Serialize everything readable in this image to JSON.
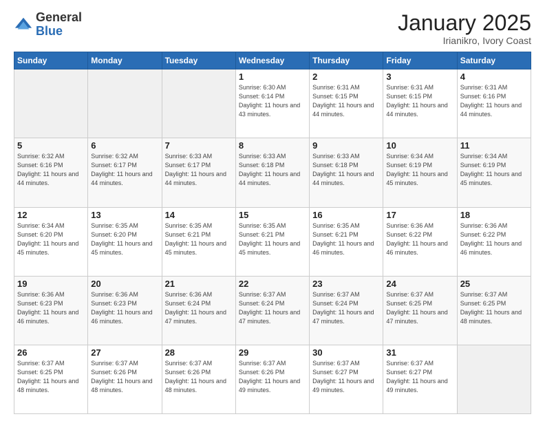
{
  "logo": {
    "general": "General",
    "blue": "Blue"
  },
  "title": "January 2025",
  "location": "Irianikro, Ivory Coast",
  "days_of_week": [
    "Sunday",
    "Monday",
    "Tuesday",
    "Wednesday",
    "Thursday",
    "Friday",
    "Saturday"
  ],
  "weeks": [
    [
      {
        "day": "",
        "info": "",
        "empty": true
      },
      {
        "day": "",
        "info": "",
        "empty": true
      },
      {
        "day": "",
        "info": "",
        "empty": true
      },
      {
        "day": "1",
        "info": "Sunrise: 6:30 AM\nSunset: 6:14 PM\nDaylight: 11 hours\nand 43 minutes."
      },
      {
        "day": "2",
        "info": "Sunrise: 6:31 AM\nSunset: 6:15 PM\nDaylight: 11 hours\nand 44 minutes."
      },
      {
        "day": "3",
        "info": "Sunrise: 6:31 AM\nSunset: 6:15 PM\nDaylight: 11 hours\nand 44 minutes."
      },
      {
        "day": "4",
        "info": "Sunrise: 6:31 AM\nSunset: 6:16 PM\nDaylight: 11 hours\nand 44 minutes."
      }
    ],
    [
      {
        "day": "5",
        "info": "Sunrise: 6:32 AM\nSunset: 6:16 PM\nDaylight: 11 hours\nand 44 minutes."
      },
      {
        "day": "6",
        "info": "Sunrise: 6:32 AM\nSunset: 6:17 PM\nDaylight: 11 hours\nand 44 minutes."
      },
      {
        "day": "7",
        "info": "Sunrise: 6:33 AM\nSunset: 6:17 PM\nDaylight: 11 hours\nand 44 minutes."
      },
      {
        "day": "8",
        "info": "Sunrise: 6:33 AM\nSunset: 6:18 PM\nDaylight: 11 hours\nand 44 minutes."
      },
      {
        "day": "9",
        "info": "Sunrise: 6:33 AM\nSunset: 6:18 PM\nDaylight: 11 hours\nand 44 minutes."
      },
      {
        "day": "10",
        "info": "Sunrise: 6:34 AM\nSunset: 6:19 PM\nDaylight: 11 hours\nand 45 minutes."
      },
      {
        "day": "11",
        "info": "Sunrise: 6:34 AM\nSunset: 6:19 PM\nDaylight: 11 hours\nand 45 minutes."
      }
    ],
    [
      {
        "day": "12",
        "info": "Sunrise: 6:34 AM\nSunset: 6:20 PM\nDaylight: 11 hours\nand 45 minutes."
      },
      {
        "day": "13",
        "info": "Sunrise: 6:35 AM\nSunset: 6:20 PM\nDaylight: 11 hours\nand 45 minutes."
      },
      {
        "day": "14",
        "info": "Sunrise: 6:35 AM\nSunset: 6:21 PM\nDaylight: 11 hours\nand 45 minutes."
      },
      {
        "day": "15",
        "info": "Sunrise: 6:35 AM\nSunset: 6:21 PM\nDaylight: 11 hours\nand 45 minutes."
      },
      {
        "day": "16",
        "info": "Sunrise: 6:35 AM\nSunset: 6:21 PM\nDaylight: 11 hours\nand 46 minutes."
      },
      {
        "day": "17",
        "info": "Sunrise: 6:36 AM\nSunset: 6:22 PM\nDaylight: 11 hours\nand 46 minutes."
      },
      {
        "day": "18",
        "info": "Sunrise: 6:36 AM\nSunset: 6:22 PM\nDaylight: 11 hours\nand 46 minutes."
      }
    ],
    [
      {
        "day": "19",
        "info": "Sunrise: 6:36 AM\nSunset: 6:23 PM\nDaylight: 11 hours\nand 46 minutes."
      },
      {
        "day": "20",
        "info": "Sunrise: 6:36 AM\nSunset: 6:23 PM\nDaylight: 11 hours\nand 46 minutes."
      },
      {
        "day": "21",
        "info": "Sunrise: 6:36 AM\nSunset: 6:24 PM\nDaylight: 11 hours\nand 47 minutes."
      },
      {
        "day": "22",
        "info": "Sunrise: 6:37 AM\nSunset: 6:24 PM\nDaylight: 11 hours\nand 47 minutes."
      },
      {
        "day": "23",
        "info": "Sunrise: 6:37 AM\nSunset: 6:24 PM\nDaylight: 11 hours\nand 47 minutes."
      },
      {
        "day": "24",
        "info": "Sunrise: 6:37 AM\nSunset: 6:25 PM\nDaylight: 11 hours\nand 47 minutes."
      },
      {
        "day": "25",
        "info": "Sunrise: 6:37 AM\nSunset: 6:25 PM\nDaylight: 11 hours\nand 48 minutes."
      }
    ],
    [
      {
        "day": "26",
        "info": "Sunrise: 6:37 AM\nSunset: 6:25 PM\nDaylight: 11 hours\nand 48 minutes."
      },
      {
        "day": "27",
        "info": "Sunrise: 6:37 AM\nSunset: 6:26 PM\nDaylight: 11 hours\nand 48 minutes."
      },
      {
        "day": "28",
        "info": "Sunrise: 6:37 AM\nSunset: 6:26 PM\nDaylight: 11 hours\nand 48 minutes."
      },
      {
        "day": "29",
        "info": "Sunrise: 6:37 AM\nSunset: 6:26 PM\nDaylight: 11 hours\nand 49 minutes."
      },
      {
        "day": "30",
        "info": "Sunrise: 6:37 AM\nSunset: 6:27 PM\nDaylight: 11 hours\nand 49 minutes."
      },
      {
        "day": "31",
        "info": "Sunrise: 6:37 AM\nSunset: 6:27 PM\nDaylight: 11 hours\nand 49 minutes."
      },
      {
        "day": "",
        "info": "",
        "empty": true
      }
    ]
  ]
}
